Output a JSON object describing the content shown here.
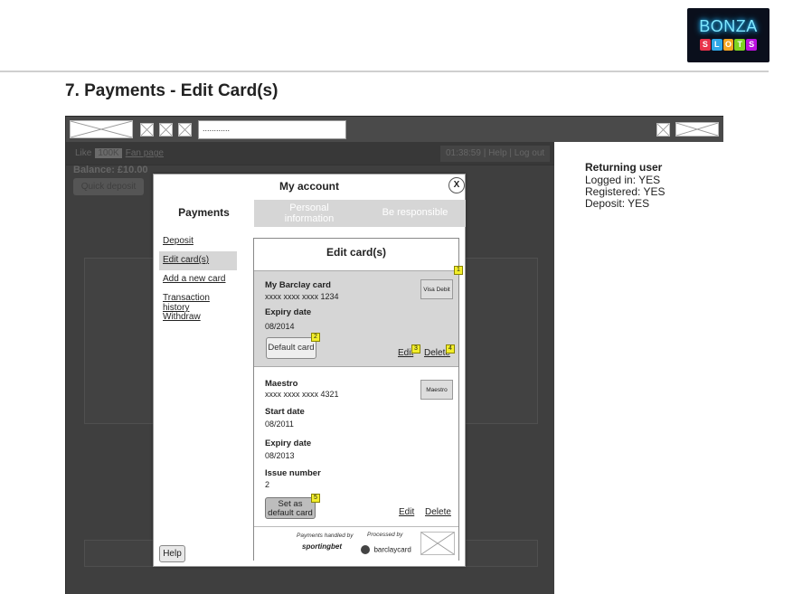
{
  "header": {
    "logo_word": "BONZA",
    "logo_letters": [
      "S",
      "L",
      "O",
      "T",
      "S"
    ],
    "logo_letter_colors": [
      "#e8324a",
      "#2fa7e8",
      "#f5a623",
      "#7ed321",
      "#bd10e0"
    ],
    "slide_title": "7. Payments - Edit Card(s)"
  },
  "browser": {
    "url_value": "............"
  },
  "site": {
    "like_label": "Like",
    "like_count": "100K",
    "fan_page": "Fan page",
    "clock": "01:38:59  |  Help  |  Log out",
    "balance": "Balance: £10.00",
    "quick_deposit": "Quick deposit"
  },
  "info": {
    "title": "Returning user",
    "lines": [
      "Logged in: YES",
      "Registered: YES",
      "Deposit: YES"
    ]
  },
  "modal": {
    "title": "My account",
    "close": "X",
    "tabs": {
      "payments": "Payments",
      "personal_line1": "Personal",
      "personal_line2": "information",
      "responsible": "Be responsible"
    },
    "sidebar": [
      "Deposit",
      "Edit card(s)",
      "Add a new card",
      "Transaction history",
      "Withdraw"
    ],
    "help": "Help"
  },
  "edit_cards": {
    "title": "Edit card(s)",
    "card1": {
      "name": "My Barclay card",
      "number": "xxxx xxxx xxxx 1234",
      "brand": "Visa Debit",
      "expiry_label": "Expiry date",
      "expiry_value": "08/2014",
      "default_button": "Default card",
      "edit": "Edit",
      "delete": "Delete"
    },
    "card2": {
      "name": "Maestro",
      "number": "xxxx xxxx xxxx 4321",
      "brand": "Maestro",
      "start_label": "Start date",
      "start_value": "08/2011",
      "expiry_label": "Expiry date",
      "expiry_value": "08/2013",
      "issue_label": "Issue number",
      "issue_value": "2",
      "set_default_line1": "Set as",
      "set_default_line2": "default card",
      "edit": "Edit",
      "delete": "Delete"
    },
    "markers": [
      "1",
      "2",
      "3",
      "4",
      "5"
    ],
    "footer": {
      "handled_by": "Payments handled by",
      "handled_brand": "sportingbet",
      "processed_by": "Processed by",
      "processed_brand": "barclaycard",
      "ssl_logo": "SSL logo"
    }
  }
}
